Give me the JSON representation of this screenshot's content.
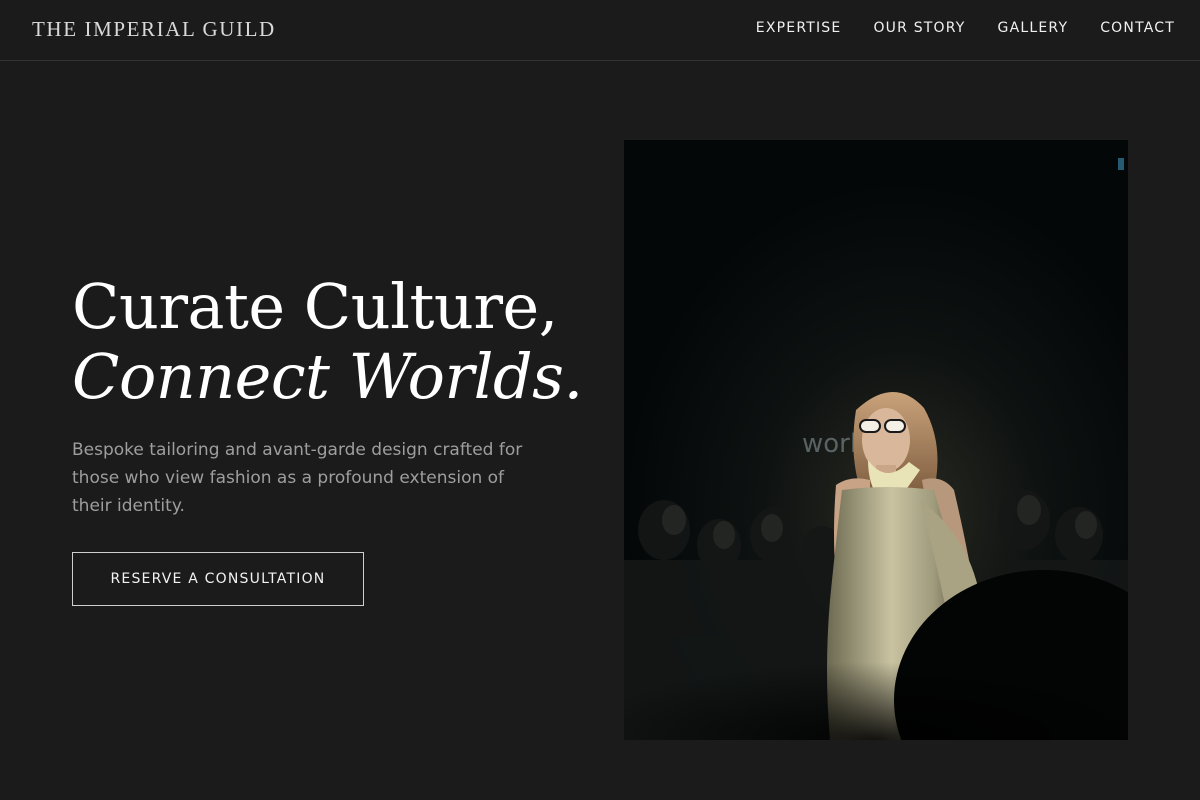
{
  "nav": {
    "brand": "THE IMPERIAL GUILD",
    "links": [
      "EXPERTISE",
      "OUR STORY",
      "GALLERY",
      "CONTACT"
    ]
  },
  "hero": {
    "headline_line1": "Curate Culture,",
    "headline_line2": "Connect Worlds.",
    "subtext": "Bespoke tailoring and avant-garde design crafted for those who view fashion as a profound extension of their identity.",
    "cta_label": "RESERVE A CONSULTATION",
    "image_watermark": "world"
  },
  "colors": {
    "background": "#1b1b1b",
    "text": "#ffffff",
    "muted_text": "#9e9e9e",
    "border": "#cfcfcf"
  }
}
